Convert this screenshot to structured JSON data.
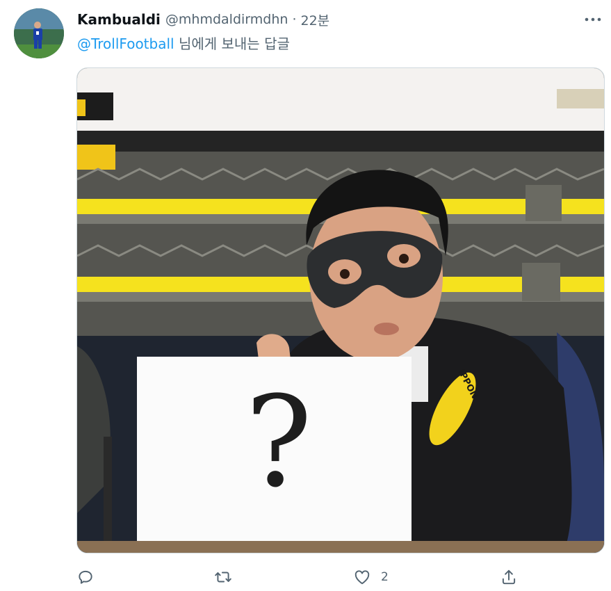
{
  "tweet": {
    "display_name": "Kambualdi",
    "handle": "@mhmdaldirmdhn",
    "separator": "·",
    "timestamp": "22분",
    "reply_to_mention": "@TrollFootball",
    "reply_to_suffix": "님에게 보내는 답글"
  },
  "media": {
    "sign_text": "?",
    "badge_text": "IPPON"
  },
  "actions": {
    "reply_icon": "reply-icon",
    "retweet_icon": "retweet-icon",
    "like_icon": "heart-icon",
    "like_count": "2",
    "share_icon": "share-icon"
  },
  "colors": {
    "link": "#1d9bf0",
    "secondary_text": "#536471",
    "border": "#cfd9de",
    "badge_yellow": "#f2d21c"
  }
}
